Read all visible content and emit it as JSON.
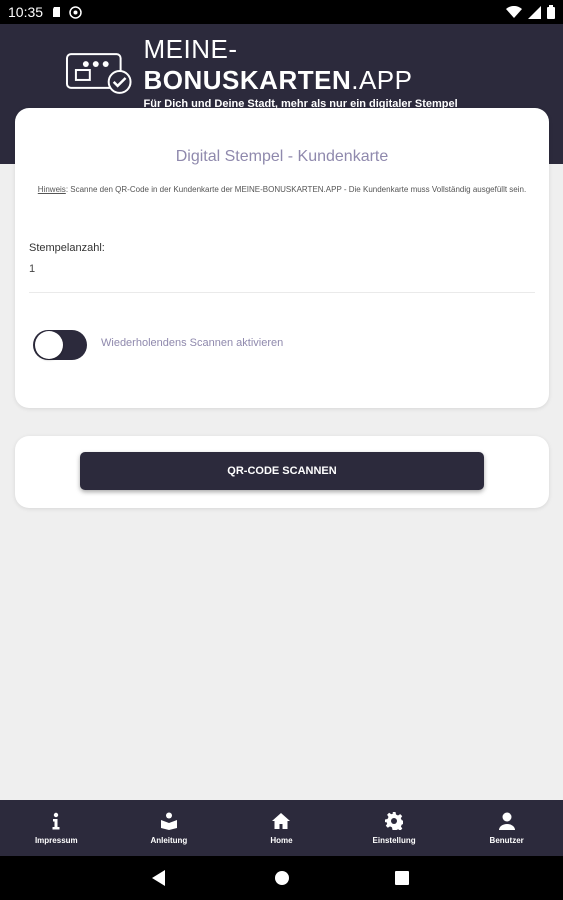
{
  "status_bar": {
    "time": "10:35",
    "left_icons": [
      "sd-card-icon",
      "vpn-icon"
    ],
    "right_icons": [
      "wifi-icon",
      "signal-icon",
      "battery-icon"
    ]
  },
  "header": {
    "brand_part1": "MEINE-",
    "brand_part2": "BONUSKARTEN",
    "brand_part3": ".APP",
    "subtitle": "Für Dich und Deine Stadt, mehr als nur ein digitaler Stempel"
  },
  "main_card": {
    "title": "Digital Stempel - Kundenkarte",
    "hint_label": "Hinweis",
    "hint_text": ": Scanne den QR-Code in der Kundenkarte der MEINE-BONUSKARTEN.APP - Die Kundenkarte muss Vollständig ausgefüllt sein.",
    "stamp_count_label": "Stempelanzahl:",
    "stamp_count_value": "1",
    "repeat_scan_label": "Wiederholendens Scannen aktivieren"
  },
  "scan_button": {
    "label": "QR-CODE SCANNEN"
  },
  "bottom_nav": {
    "items": [
      {
        "label": "Impressum",
        "icon": "info-icon"
      },
      {
        "label": "Anleitung",
        "icon": "book-reader-icon"
      },
      {
        "label": "Home",
        "icon": "home-icon"
      },
      {
        "label": "Einstellung",
        "icon": "gear-icon"
      },
      {
        "label": "Benutzer",
        "icon": "user-icon"
      }
    ]
  },
  "colors": {
    "primary": "#2c2a3c",
    "accent_text": "#8f89ad",
    "background": "#efefef"
  }
}
